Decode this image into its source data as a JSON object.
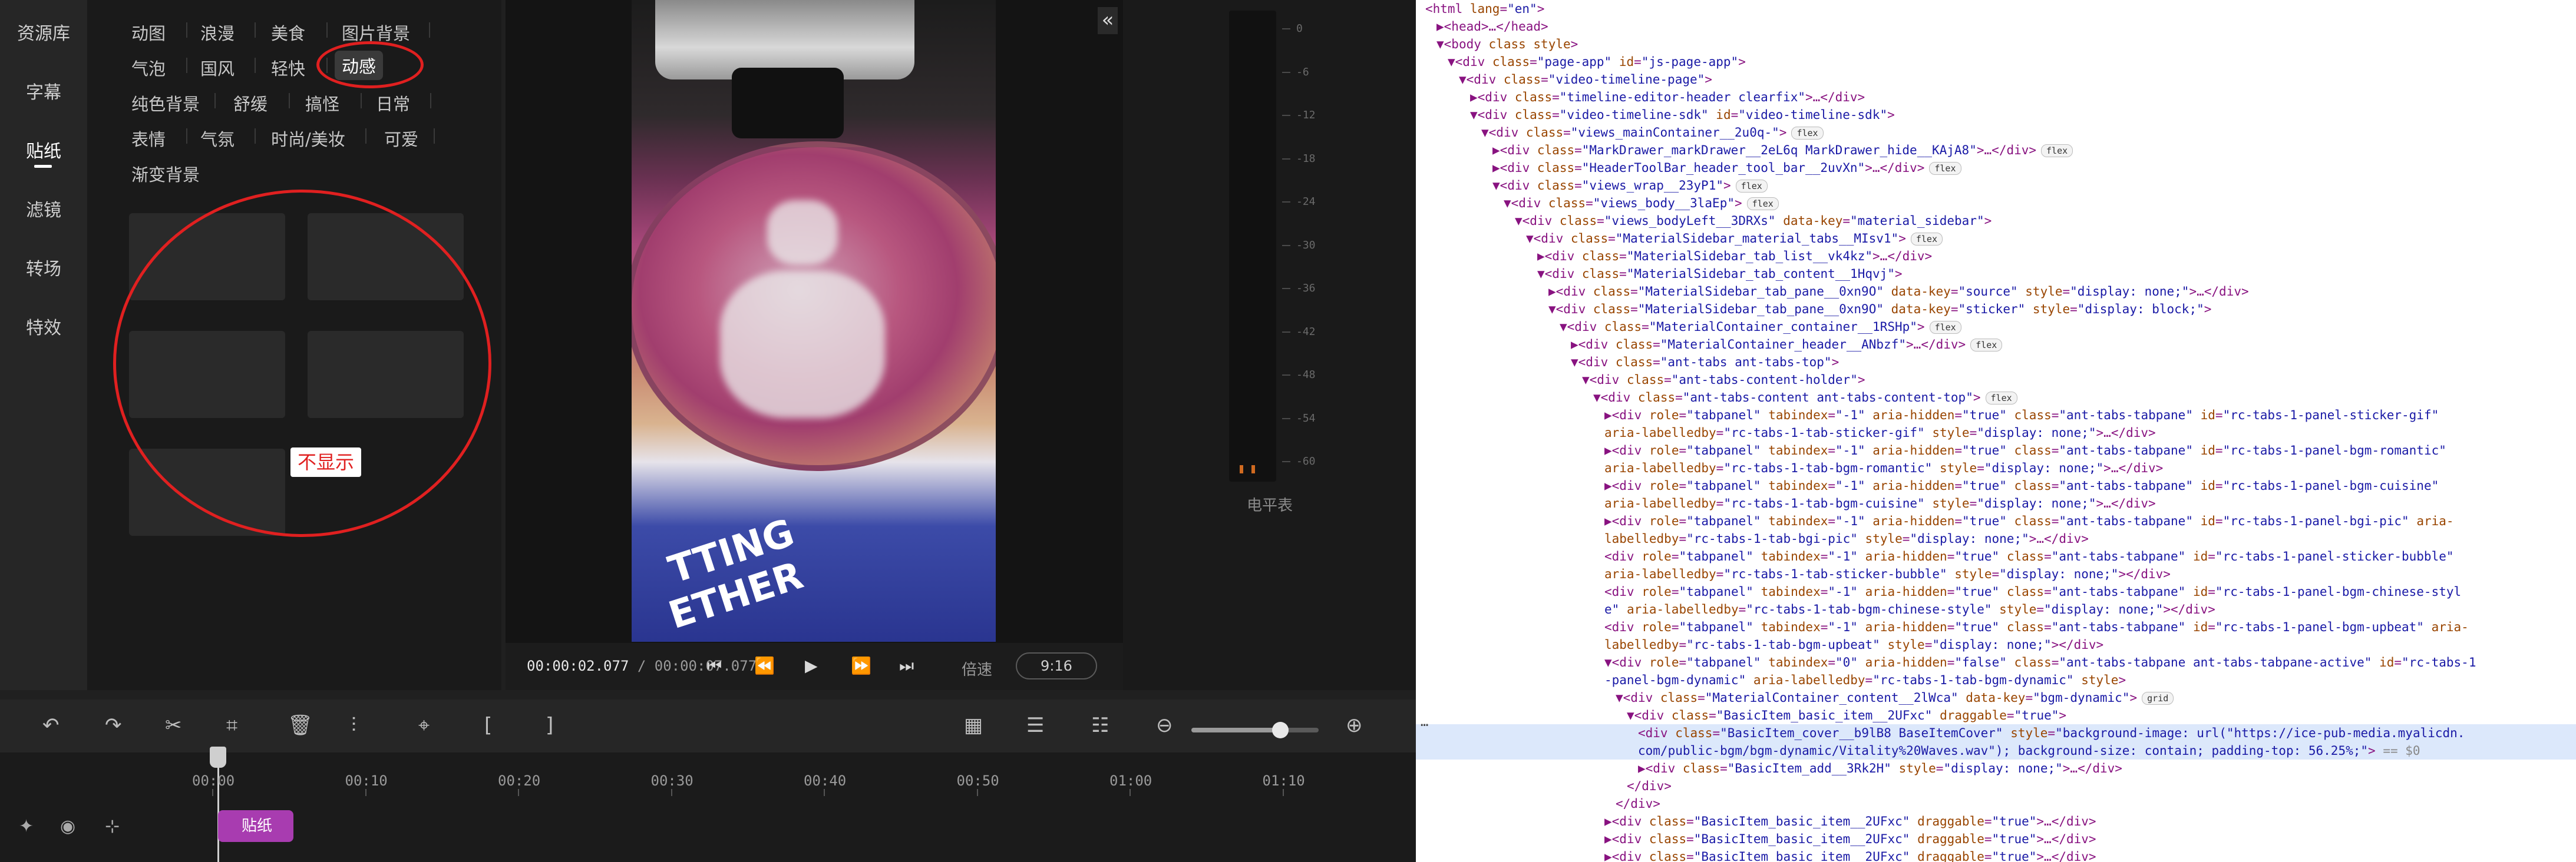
{
  "nav": {
    "items": [
      {
        "label": "资源库"
      },
      {
        "label": "字幕"
      },
      {
        "label": "贴纸",
        "active": true
      },
      {
        "label": "滤镜"
      },
      {
        "label": "转场"
      },
      {
        "label": "特效"
      }
    ]
  },
  "categories": {
    "rows": [
      [
        "动图",
        "浪漫",
        "美食",
        "图片背景"
      ],
      [
        "气泡",
        "国风",
        "轻快",
        "动感"
      ],
      [
        "纯色背景",
        "舒缓",
        "搞怪",
        "日常"
      ],
      [
        "表情",
        "气氛",
        "时尚/美妆",
        "可爱"
      ],
      [
        "渐变背景"
      ]
    ],
    "active": "动感"
  },
  "annotation": {
    "label": "不显示",
    "color": "#e02020"
  },
  "preview": {
    "bag_text_1": "TTING",
    "bag_text_2": "ETHER",
    "collapse_icon": "«"
  },
  "playback": {
    "current": "00:00:02.077",
    "separator": " / ",
    "total": "00:00:07.077",
    "speed_label": "倍速",
    "ratio": "9:16",
    "icons": {
      "prev": "⏮",
      "rewind": "⏪",
      "play": "▶",
      "forward": "⏩",
      "next": "⏭"
    }
  },
  "meter": {
    "ticks": [
      "0",
      "-6",
      "-12",
      "-18",
      "-24",
      "-30",
      "-36",
      "-42",
      "-48",
      "-54",
      "-60"
    ],
    "label": "电平表"
  },
  "toolbar": {
    "icons": {
      "undo": "↶",
      "redo": "↷",
      "cut": "✂",
      "crop": "⌗",
      "delete": "🗑",
      "audio": "⫶",
      "marker": "⌖",
      "bracket_open": "[",
      "bracket_close": "]",
      "view1": "▦",
      "view2": "☰",
      "view3": "☷",
      "zoom_out": "⊖",
      "zoom_in": "⊕"
    },
    "zoom_level": 0.7
  },
  "timeline": {
    "ruler": [
      "00:00",
      "00:10",
      "00:20",
      "00:30",
      "00:40",
      "00:50",
      "01:00",
      "01:10"
    ],
    "clip_label": "贴纸",
    "icons": {
      "pin": "✦",
      "eye": "◉",
      "split": "⊹"
    }
  },
  "devtools": {
    "lines": [
      {
        "indent": 0,
        "html": "<span class=\"tg\">&lt;html</span> <span class=\"an\">lang</span>=<span class=\"av\">\"en\"</span><span class=\"tg\">&gt;</span>"
      },
      {
        "indent": 1,
        "html": "▶<span class=\"tg\">&lt;head&gt;</span>…<span class=\"tg\">&lt;/head&gt;</span>"
      },
      {
        "indent": 1,
        "html": "▼<span class=\"tg\">&lt;body</span> <span class=\"an\">class</span> <span class=\"an\">style</span><span class=\"tg\">&gt;</span>"
      },
      {
        "indent": 2,
        "html": "▼<span class=\"tg\">&lt;div</span> <span class=\"an\">class</span>=<span class=\"av\">\"page-app\"</span> <span class=\"an\">id</span>=<span class=\"av\">\"js-page-app\"</span><span class=\"tg\">&gt;</span>"
      },
      {
        "indent": 3,
        "html": "▼<span class=\"tg\">&lt;div</span> <span class=\"an\">class</span>=<span class=\"av\">\"video-timeline-page\"</span><span class=\"tg\">&gt;</span>"
      },
      {
        "indent": 4,
        "html": "▶<span class=\"tg\">&lt;div</span> <span class=\"an\">class</span>=<span class=\"av\">\"timeline-editor-header clearfix\"</span><span class=\"tg\">&gt;</span>…<span class=\"tg\">&lt;/div&gt;</span>"
      },
      {
        "indent": 4,
        "html": "▼<span class=\"tg\">&lt;div</span> <span class=\"an\">class</span>=<span class=\"av\">\"video-timeline-sdk\"</span> <span class=\"an\">id</span>=<span class=\"av\">\"video-timeline-sdk\"</span><span class=\"tg\">&gt;</span>"
      },
      {
        "indent": 5,
        "html": "▼<span class=\"tg\">&lt;div</span> <span class=\"an\">class</span>=<span class=\"av\">\"views_mainContainer__2u0q-\"</span><span class=\"tg\">&gt;</span><span class=\"pill\">flex</span>"
      },
      {
        "indent": 6,
        "html": "▶<span class=\"tg\">&lt;div</span> <span class=\"an\">class</span>=<span class=\"av\">\"MarkDrawer_markDrawer__2eL6q MarkDrawer_hide__KAjA8\"</span><span class=\"tg\">&gt;</span>…<span class=\"tg\">&lt;/div&gt;</span><span class=\"pill\">flex</span>"
      },
      {
        "indent": 6,
        "html": "▶<span class=\"tg\">&lt;div</span> <span class=\"an\">class</span>=<span class=\"av\">\"HeaderToolBar_header_tool_bar__2uvXn\"</span><span class=\"tg\">&gt;</span>…<span class=\"tg\">&lt;/div&gt;</span><span class=\"pill\">flex</span>"
      },
      {
        "indent": 6,
        "html": "▼<span class=\"tg\">&lt;div</span> <span class=\"an\">class</span>=<span class=\"av\">\"views_wrap__23yP1\"</span><span class=\"tg\">&gt;</span><span class=\"pill\">flex</span>"
      },
      {
        "indent": 7,
        "html": "▼<span class=\"tg\">&lt;div</span> <span class=\"an\">class</span>=<span class=\"av\">\"views_body__3laEp\"</span><span class=\"tg\">&gt;</span><span class=\"pill\">flex</span>"
      },
      {
        "indent": 8,
        "html": "▼<span class=\"tg\">&lt;div</span> <span class=\"an\">class</span>=<span class=\"av\">\"views_bodyLeft__3DRXs\"</span> <span class=\"an\">data-key</span>=<span class=\"av\">\"material_sidebar\"</span><span class=\"tg\">&gt;</span>"
      },
      {
        "indent": 9,
        "html": "▼<span class=\"tg\">&lt;div</span> <span class=\"an\">class</span>=<span class=\"av\">\"MaterialSidebar_material_tabs__MIsv1\"</span><span class=\"tg\">&gt;</span><span class=\"pill\">flex</span>"
      },
      {
        "indent": 10,
        "html": "▶<span class=\"tg\">&lt;div</span> <span class=\"an\">class</span>=<span class=\"av\">\"MaterialSidebar_tab_list__vk4kz\"</span><span class=\"tg\">&gt;</span>…<span class=\"tg\">&lt;/div&gt;</span>"
      },
      {
        "indent": 10,
        "html": "▼<span class=\"tg\">&lt;div</span> <span class=\"an\">class</span>=<span class=\"av\">\"MaterialSidebar_tab_content__1Hqvj\"</span><span class=\"tg\">&gt;</span>"
      },
      {
        "indent": 11,
        "html": "▶<span class=\"tg\">&lt;div</span> <span class=\"an\">class</span>=<span class=\"av\">\"MaterialSidebar_tab_pane__0xn9O\"</span> <span class=\"an\">data-key</span>=<span class=\"av\">\"source\"</span> <span class=\"an\">style</span>=<span class=\"av\">\"display: none;\"</span><span class=\"tg\">&gt;</span>…<span class=\"tg\">&lt;/div&gt;</span>"
      },
      {
        "indent": 11,
        "html": "▼<span class=\"tg\">&lt;div</span> <span class=\"an\">class</span>=<span class=\"av\">\"MaterialSidebar_tab_pane__0xn9O\"</span> <span class=\"an\">data-key</span>=<span class=\"av\">\"sticker\"</span> <span class=\"an\">style</span>=<span class=\"av\">\"display: block;\"</span><span class=\"tg\">&gt;</span>"
      },
      {
        "indent": 12,
        "html": "▼<span class=\"tg\">&lt;div</span> <span class=\"an\">class</span>=<span class=\"av\">\"MaterialContainer_container__1RSHp\"</span><span class=\"tg\">&gt;</span><span class=\"pill\">flex</span>"
      },
      {
        "indent": 13,
        "html": "▶<span class=\"tg\">&lt;div</span> <span class=\"an\">class</span>=<span class=\"av\">\"MaterialContainer_header__ANbzf\"</span><span class=\"tg\">&gt;</span>…<span class=\"tg\">&lt;/div&gt;</span><span class=\"pill\">flex</span>"
      },
      {
        "indent": 13,
        "html": "▼<span class=\"tg\">&lt;div</span> <span class=\"an\">class</span>=<span class=\"av\">\"ant-tabs ant-tabs-top\"</span><span class=\"tg\">&gt;</span>"
      },
      {
        "indent": 14,
        "html": "▼<span class=\"tg\">&lt;div</span> <span class=\"an\">class</span>=<span class=\"av\">\"ant-tabs-content-holder\"</span><span class=\"tg\">&gt;</span>"
      },
      {
        "indent": 15,
        "html": "▼<span class=\"tg\">&lt;div</span> <span class=\"an\">class</span>=<span class=\"av\">\"ant-tabs-content ant-tabs-content-top\"</span><span class=\"tg\">&gt;</span><span class=\"pill\">flex</span>"
      },
      {
        "indent": 16,
        "html": "▶<span class=\"tg\">&lt;div</span> <span class=\"an\">role</span>=<span class=\"av\">\"tabpanel\"</span> <span class=\"an\">tabindex</span>=<span class=\"av\">\"-1\"</span> <span class=\"an\">aria-hidden</span>=<span class=\"av\">\"true\"</span> <span class=\"an\">class</span>=<span class=\"av\">\"ant-tabs-tabpane\"</span> <span class=\"an\">id</span>=<span class=\"av\">\"rc-tabs-1-panel-sticker-gif\"</span>"
      },
      {
        "indent": 16,
        "html": "<span class=\"an\">aria-labelledby</span>=<span class=\"av\">\"rc-tabs-1-tab-sticker-gif\"</span> <span class=\"an\">style</span>=<span class=\"av\">\"display: none;\"</span><span class=\"tg\">&gt;</span>…<span class=\"tg\">&lt;/div&gt;</span>"
      },
      {
        "indent": 16,
        "html": "▶<span class=\"tg\">&lt;div</span> <span class=\"an\">role</span>=<span class=\"av\">\"tabpanel\"</span> <span class=\"an\">tabindex</span>=<span class=\"av\">\"-1\"</span> <span class=\"an\">aria-hidden</span>=<span class=\"av\">\"true\"</span> <span class=\"an\">class</span>=<span class=\"av\">\"ant-tabs-tabpane\"</span> <span class=\"an\">id</span>=<span class=\"av\">\"rc-tabs-1-panel-bgm-romantic\"</span>"
      },
      {
        "indent": 16,
        "html": "<span class=\"an\">aria-labelledby</span>=<span class=\"av\">\"rc-tabs-1-tab-bgm-romantic\"</span> <span class=\"an\">style</span>=<span class=\"av\">\"display: none;\"</span><span class=\"tg\">&gt;</span>…<span class=\"tg\">&lt;/div&gt;</span>"
      },
      {
        "indent": 16,
        "html": "▶<span class=\"tg\">&lt;div</span> <span class=\"an\">role</span>=<span class=\"av\">\"tabpanel\"</span> <span class=\"an\">tabindex</span>=<span class=\"av\">\"-1\"</span> <span class=\"an\">aria-hidden</span>=<span class=\"av\">\"true\"</span> <span class=\"an\">class</span>=<span class=\"av\">\"ant-tabs-tabpane\"</span> <span class=\"an\">id</span>=<span class=\"av\">\"rc-tabs-1-panel-bgm-cuisine\"</span>"
      },
      {
        "indent": 16,
        "html": "<span class=\"an\">aria-labelledby</span>=<span class=\"av\">\"rc-tabs-1-tab-bgm-cuisine\"</span> <span class=\"an\">style</span>=<span class=\"av\">\"display: none;\"</span><span class=\"tg\">&gt;</span>…<span class=\"tg\">&lt;/div&gt;</span>"
      },
      {
        "indent": 16,
        "html": "▶<span class=\"tg\">&lt;div</span> <span class=\"an\">role</span>=<span class=\"av\">\"tabpanel\"</span> <span class=\"an\">tabindex</span>=<span class=\"av\">\"-1\"</span> <span class=\"an\">aria-hidden</span>=<span class=\"av\">\"true\"</span> <span class=\"an\">class</span>=<span class=\"av\">\"ant-tabs-tabpane\"</span> <span class=\"an\">id</span>=<span class=\"av\">\"rc-tabs-1-panel-bgi-pic\"</span> <span class=\"an\">aria-</span>"
      },
      {
        "indent": 16,
        "html": "<span class=\"an\">labelledby</span>=<span class=\"av\">\"rc-tabs-1-tab-bgi-pic\"</span> <span class=\"an\">style</span>=<span class=\"av\">\"display: none;\"</span><span class=\"tg\">&gt;</span>…<span class=\"tg\">&lt;/div&gt;</span>"
      },
      {
        "indent": 16,
        "html": "<span class=\"tg\">&lt;div</span> <span class=\"an\">role</span>=<span class=\"av\">\"tabpanel\"</span> <span class=\"an\">tabindex</span>=<span class=\"av\">\"-1\"</span> <span class=\"an\">aria-hidden</span>=<span class=\"av\">\"true\"</span> <span class=\"an\">class</span>=<span class=\"av\">\"ant-tabs-tabpane\"</span> <span class=\"an\">id</span>=<span class=\"av\">\"rc-tabs-1-panel-sticker-bubble\"</span>"
      },
      {
        "indent": 16,
        "html": "<span class=\"an\">aria-labelledby</span>=<span class=\"av\">\"rc-tabs-1-tab-sticker-bubble\"</span> <span class=\"an\">style</span>=<span class=\"av\">\"display: none;\"</span><span class=\"tg\">&gt;&lt;/div&gt;</span>"
      },
      {
        "indent": 16,
        "html": "<span class=\"tg\">&lt;div</span> <span class=\"an\">role</span>=<span class=\"av\">\"tabpanel\"</span> <span class=\"an\">tabindex</span>=<span class=\"av\">\"-1\"</span> <span class=\"an\">aria-hidden</span>=<span class=\"av\">\"true\"</span> <span class=\"an\">class</span>=<span class=\"av\">\"ant-tabs-tabpane\"</span> <span class=\"an\">id</span>=<span class=\"av\">\"rc-tabs-1-panel-bgm-chinese-styl</span>"
      },
      {
        "indent": 16,
        "html": "<span class=\"av\">e\"</span> <span class=\"an\">aria-labelledby</span>=<span class=\"av\">\"rc-tabs-1-tab-bgm-chinese-style\"</span> <span class=\"an\">style</span>=<span class=\"av\">\"display: none;\"</span><span class=\"tg\">&gt;&lt;/div&gt;</span>"
      },
      {
        "indent": 16,
        "html": "<span class=\"tg\">&lt;div</span> <span class=\"an\">role</span>=<span class=\"av\">\"tabpanel\"</span> <span class=\"an\">tabindex</span>=<span class=\"av\">\"-1\"</span> <span class=\"an\">aria-hidden</span>=<span class=\"av\">\"true\"</span> <span class=\"an\">class</span>=<span class=\"av\">\"ant-tabs-tabpane\"</span> <span class=\"an\">id</span>=<span class=\"av\">\"rc-tabs-1-panel-bgm-upbeat\"</span> <span class=\"an\">aria-</span>"
      },
      {
        "indent": 16,
        "html": "<span class=\"an\">labelledby</span>=<span class=\"av\">\"rc-tabs-1-tab-bgm-upbeat\"</span> <span class=\"an\">style</span>=<span class=\"av\">\"display: none;\"</span><span class=\"tg\">&gt;&lt;/div&gt;</span>"
      },
      {
        "indent": 16,
        "html": "▼<span class=\"tg\">&lt;div</span> <span class=\"an\">role</span>=<span class=\"av\">\"tabpanel\"</span> <span class=\"an\">tabindex</span>=<span class=\"av\">\"0\"</span> <span class=\"an\">aria-hidden</span>=<span class=\"av\">\"false\"</span> <span class=\"an\">class</span>=<span class=\"av\">\"ant-tabs-tabpane ant-tabs-tabpane-active\"</span> <span class=\"an\">id</span>=<span class=\"av\">\"rc-tabs-1</span>"
      },
      {
        "indent": 16,
        "html": "<span class=\"av\">-panel-bgm-dynamic\"</span> <span class=\"an\">aria-labelledby</span>=<span class=\"av\">\"rc-tabs-1-tab-bgm-dynamic\"</span> <span class=\"an\">style</span><span class=\"tg\">&gt;</span>"
      },
      {
        "indent": 17,
        "html": "▼<span class=\"tg\">&lt;div</span> <span class=\"an\">class</span>=<span class=\"av\">\"MaterialContainer_content__2lWca\"</span> <span class=\"an\">data-key</span>=<span class=\"av\">\"bgm-dynamic\"</span><span class=\"tg\">&gt;</span><span class=\"pill\">grid</span>"
      },
      {
        "indent": 18,
        "html": "▼<span class=\"tg\">&lt;div</span> <span class=\"an\">class</span>=<span class=\"av\">\"BasicItem_basic_item__2UFxc\"</span> <span class=\"an\">draggable</span>=<span class=\"av\">\"true\"</span><span class=\"tg\">&gt;</span>"
      },
      {
        "indent": 19,
        "html": "<span class=\"tg\">&lt;div</span> <span class=\"an\">class</span>=<span class=\"av\">\"BasicItem_cover__b9lB8 BaseItemCover\"</span> <span class=\"an\">style</span>=<span class=\"av\">\"background-image: url(\"https://ice-pub-media.myalicdn.</span>",
        "selected": true
      },
      {
        "indent": 19,
        "html": "<span class=\"av\">com/public-bgm/bgm-dynamic/Vitality%20Waves.wav\"); background-size: contain; padding-top: 56.25%;\"</span><span class=\"tg\">&gt;</span> <span class=\"eq\">== $0</span>",
        "selected": true
      },
      {
        "indent": 19,
        "html": "▶<span class=\"tg\">&lt;div</span> <span class=\"an\">class</span>=<span class=\"av\">\"BasicItem_add__3Rk2H\"</span> <span class=\"an\">style</span>=<span class=\"av\">\"display: none;\"</span><span class=\"tg\">&gt;</span>…<span class=\"tg\">&lt;/div&gt;</span>"
      },
      {
        "indent": 18,
        "html": "<span class=\"tg\">&lt;/div&gt;</span>"
      },
      {
        "indent": 17,
        "html": "<span class=\"tg\">&lt;/div&gt;</span>"
      },
      {
        "indent": 16,
        "html": "▶<span class=\"tg\">&lt;div</span> <span class=\"an\">class</span>=<span class=\"av\">\"BasicItem_basic_item__2UFxc\"</span> <span class=\"an\">draggable</span>=<span class=\"av\">\"true\"</span><span class=\"tg\">&gt;</span>…<span class=\"tg\">&lt;/div&gt;</span>"
      },
      {
        "indent": 16,
        "html": "▶<span class=\"tg\">&lt;div</span> <span class=\"an\">class</span>=<span class=\"av\">\"BasicItem_basic_item__2UFxc\"</span> <span class=\"an\">draggable</span>=<span class=\"av\">\"true\"</span><span class=\"tg\">&gt;</span>…<span class=\"tg\">&lt;/div&gt;</span>"
      },
      {
        "indent": 16,
        "html": "▶<span class=\"tg\">&lt;div</span> <span class=\"an\">class</span>=<span class=\"av\">\"BasicItem_basic_item__2UFxc\"</span> <span class=\"an\">draggable</span>=<span class=\"av\">\"true\"</span><span class=\"tg\">&gt;</span>…<span class=\"tg\">&lt;/div&gt;</span>"
      }
    ],
    "gutter_dots": "…"
  }
}
